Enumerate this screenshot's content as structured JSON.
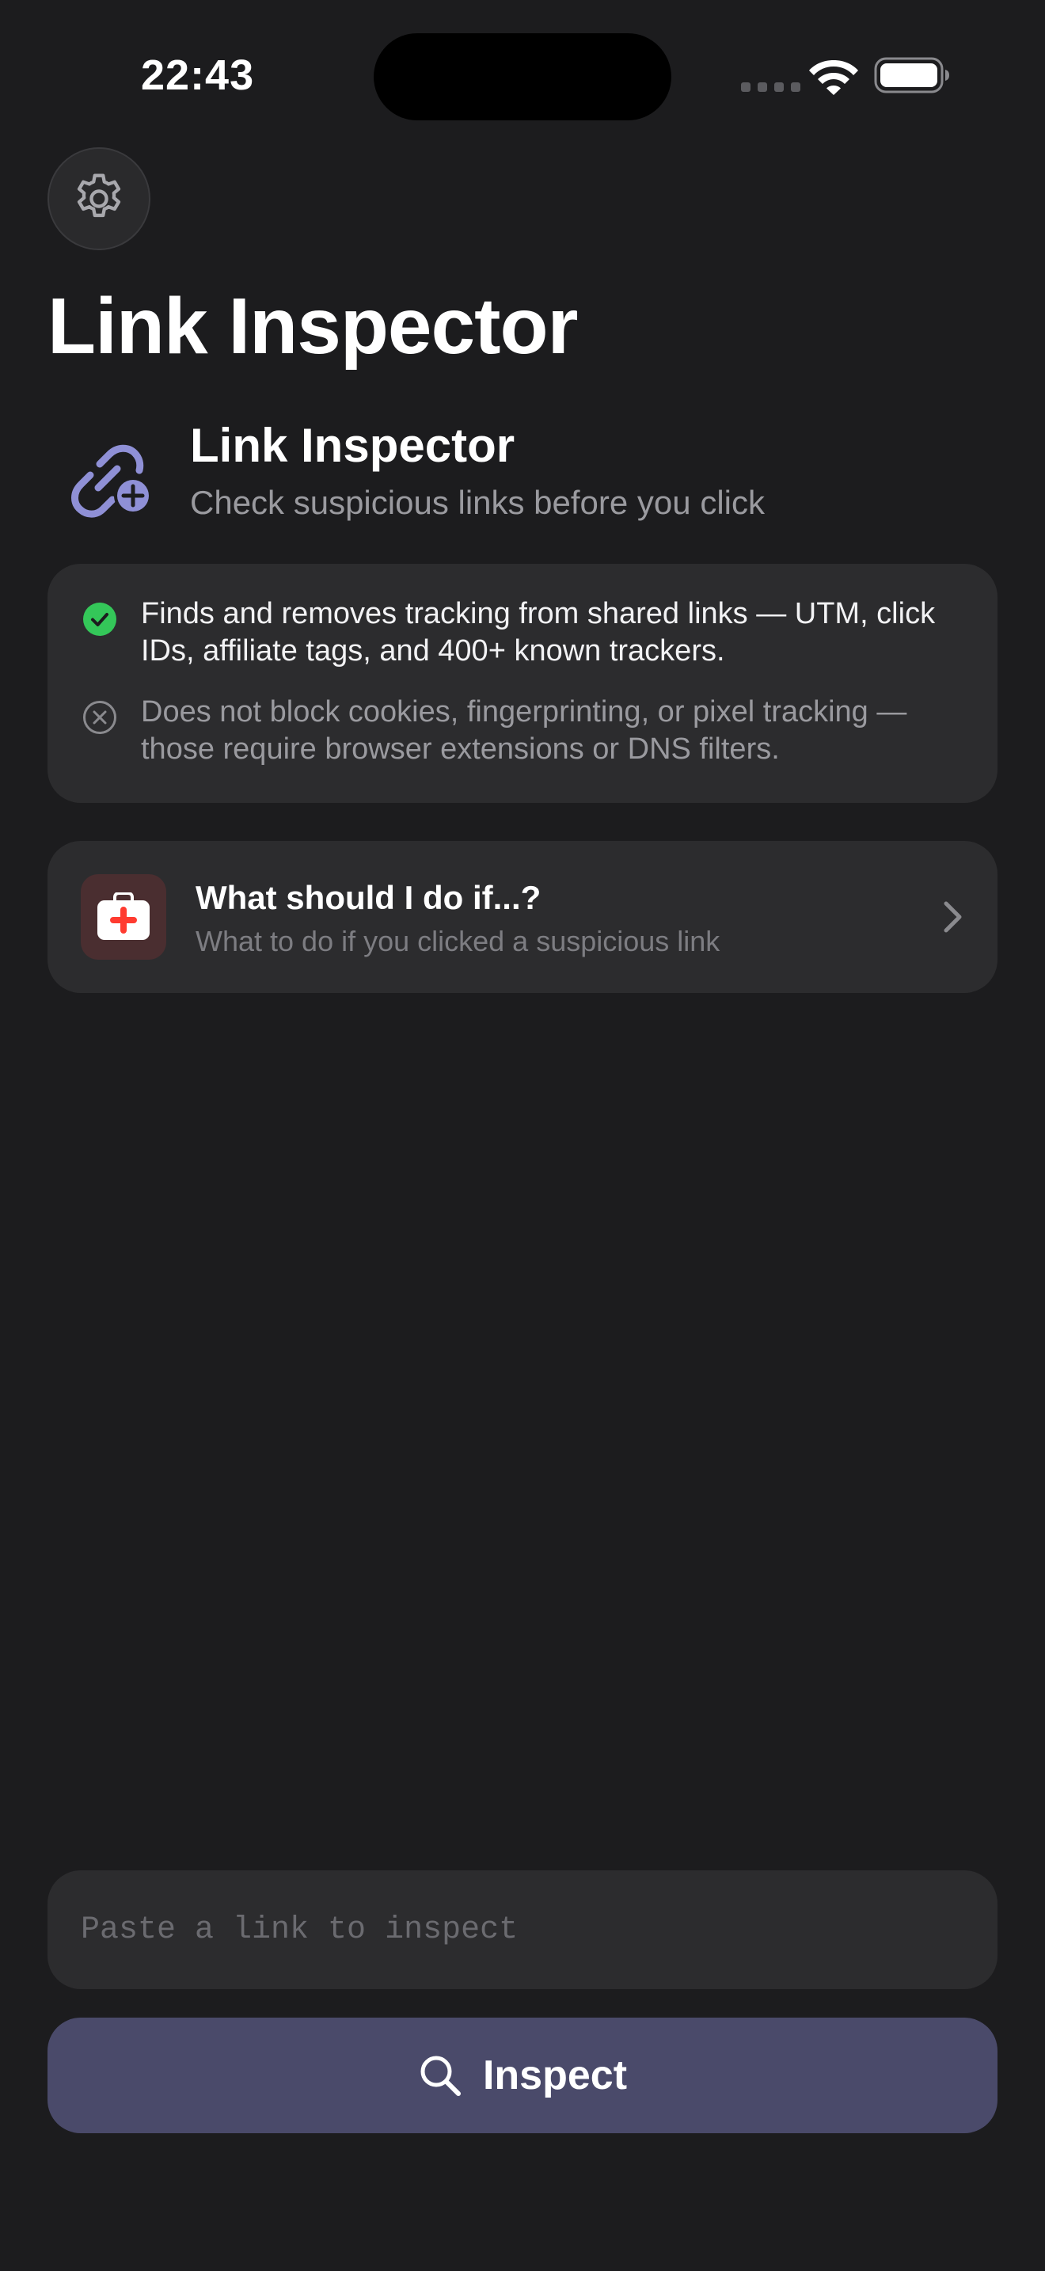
{
  "status_bar": {
    "time": "22:43",
    "icons": [
      "signal-dots-icon",
      "wifi-icon",
      "battery-icon"
    ]
  },
  "navigation": {
    "large_title": "Link Inspector",
    "settings_icon": "gear-icon"
  },
  "header": {
    "logo_icon": "link-add-icon",
    "title": "Link Inspector",
    "subtitle": "Check suspicious links before you click"
  },
  "info_card": {
    "does": {
      "icon": "checkmark-circle-icon",
      "text": "Finds and removes tracking from shared links — UTM, click IDs, affiliate tags, and 400+ known trackers."
    },
    "does_not": {
      "icon": "xmark-circle-icon",
      "text": "Does not block cookies, fingerprinting, or pixel tracking — those require browser extensions or DNS filters."
    }
  },
  "help_card": {
    "icon": "first-aid-kit-icon",
    "title": "What should I do if...?",
    "subtitle": "What to do if you clicked a suspicious link"
  },
  "link_input": {
    "value": "",
    "placeholder": "Paste a link to inspect"
  },
  "inspect_button": {
    "icon": "magnifying-glass-icon",
    "label": "Inspect"
  },
  "colors": {
    "background": "#1c1c1e",
    "card": "#2c2c2e",
    "accent": "#8f90d6",
    "button": "#4a4a6a",
    "success": "#34c759",
    "danger": "#ff3b30",
    "secondary_text": "#9a9a9f"
  }
}
